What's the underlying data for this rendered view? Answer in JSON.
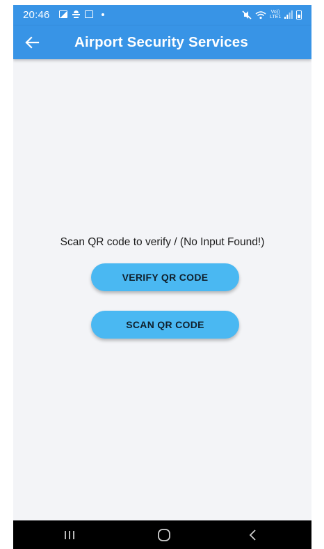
{
  "status_bar": {
    "time": "20:46",
    "left_icons": [
      "gallery-icon",
      "weather-icon",
      "tablet-icon",
      "dot-icon"
    ],
    "right_icons": [
      "mute-icon",
      "wifi-icon",
      "volte-icon",
      "signal-icon",
      "battery-icon"
    ],
    "volte_line1": "Vo))",
    "volte_line2": "LTE1"
  },
  "app_bar": {
    "back_icon": "arrow-left-icon",
    "title": "Airport Security Services",
    "color": "#3894e6"
  },
  "main": {
    "message": "Scan QR code to verify / (No Input Found!)",
    "buttons": {
      "verify_label": "VERIFY QR CODE",
      "scan_label": "SCAN QR CODE"
    },
    "button_color": "#4ab8f2",
    "background": "#f3f4f7"
  },
  "nav_bar": {
    "icons": [
      "recents-icon",
      "home-icon",
      "back-icon"
    ],
    "color": "#000000"
  }
}
